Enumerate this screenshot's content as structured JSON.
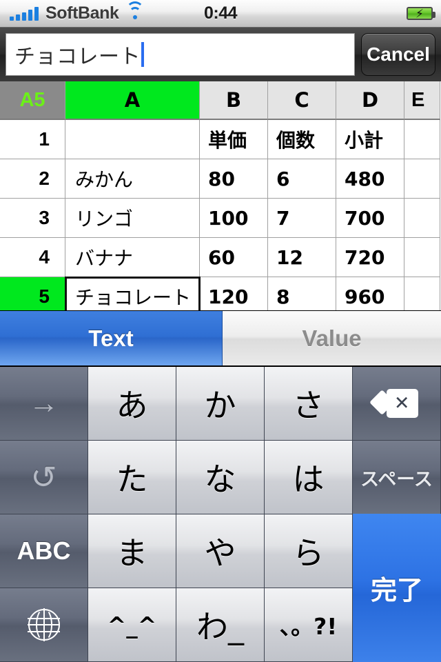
{
  "status_bar": {
    "carrier": "SoftBank",
    "time": "0:44",
    "signal_icon": "signal-bars-icon",
    "wifi_icon": "wifi-icon",
    "battery_icon": "battery-charging-icon",
    "battery_bolt": "⚡",
    "signal_bars": 5,
    "accent_blue": "#1b7fe0",
    "battery_green": "#63c427"
  },
  "search_bar": {
    "value": "チョコレート",
    "placeholder": "",
    "cancel_label": "Cancel",
    "caret_color": "#2a6df0"
  },
  "sheet": {
    "active_cell": "A5",
    "selected_column": "A",
    "selected_row": "5",
    "selection_green": "#00e81e",
    "corner_text_color": "#6cf018",
    "columns": [
      "A",
      "B",
      "C",
      "D",
      "E"
    ],
    "rows": [
      {
        "index": "1",
        "A": "",
        "B": "単価",
        "C": "個数",
        "D": "小計",
        "E": ""
      },
      {
        "index": "2",
        "A": "みかん",
        "B": "80",
        "C": "6",
        "D": "480",
        "E": ""
      },
      {
        "index": "3",
        "A": "リンゴ",
        "B": "100",
        "C": "7",
        "D": "700",
        "E": ""
      },
      {
        "index": "4",
        "A": "バナナ",
        "B": "60",
        "C": "12",
        "D": "720",
        "E": ""
      },
      {
        "index": "5",
        "A": "チョコレート",
        "B": "120",
        "C": "8",
        "D": "960",
        "E": ""
      }
    ]
  },
  "segmented_control": {
    "text_label": "Text",
    "value_label": "Value",
    "selected": "Text",
    "selected_color": "#2f6fd4"
  },
  "keyboard": {
    "type": "japanese-kana-10key",
    "rows": [
      {
        "left": "→",
        "keys": [
          "あ",
          "か",
          "さ"
        ],
        "right": "delete"
      },
      {
        "left": "↺",
        "keys": [
          "た",
          "な",
          "は"
        ],
        "right": "スペース"
      },
      {
        "left": "ABC",
        "keys": [
          "ま",
          "や",
          "ら"
        ],
        "right": "完了"
      },
      {
        "left": "globe",
        "keys": [
          "^_^",
          "わ_",
          "、。?!"
        ],
        "right": ""
      }
    ],
    "left_icons": [
      "arrow-right-icon",
      "undo-icon",
      "abc-key",
      "globe-icon"
    ],
    "delete_icon": "delete-backspace-icon",
    "delete_glyph": "✕",
    "space_label": "スペース",
    "done_label": "完了",
    "abc_label": "ABC",
    "done_color": "#2d72e4"
  }
}
